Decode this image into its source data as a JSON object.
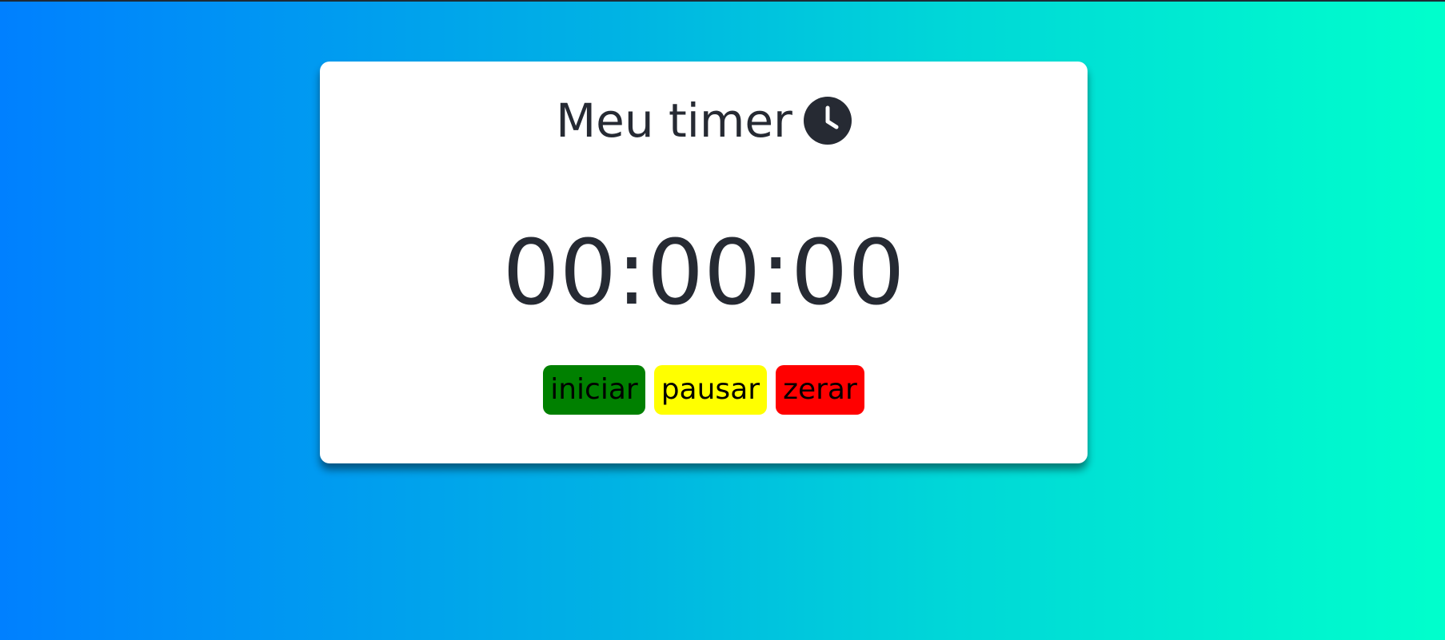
{
  "page": {
    "title": "Meu timer",
    "title_icon": "clock-icon"
  },
  "timer": {
    "display": "00:00:00"
  },
  "buttons": {
    "start": {
      "label": "iniciar",
      "color": "#008000"
    },
    "pause": {
      "label": "pausar",
      "color": "#ffff00"
    },
    "reset": {
      "label": "zerar",
      "color": "#ff0000"
    }
  },
  "colors": {
    "background_start": "#0080ff",
    "background_end": "#00ffcc",
    "card": "#ffffff",
    "text": "#262a33"
  }
}
